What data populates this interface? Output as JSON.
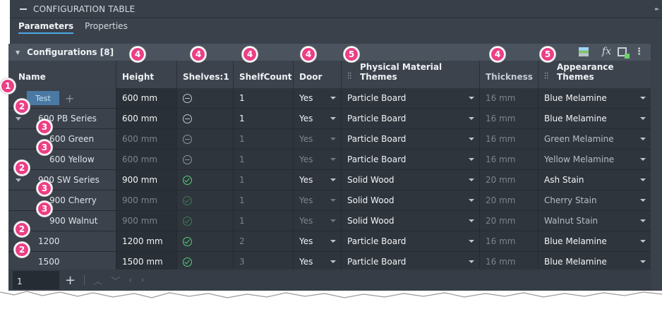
{
  "panel": {
    "title": "CONFIGURATION TABLE"
  },
  "tabs": [
    {
      "label": "Parameters",
      "active": true
    },
    {
      "label": "Properties",
      "active": false
    }
  ],
  "config_bar": {
    "label": "Configurations [8]"
  },
  "columns": {
    "name": "Name",
    "height": "Height",
    "shelves": "Shelves:1",
    "shelfcount": "ShelfCount",
    "door": "Door",
    "material": "Physical Material Themes",
    "thickness": "Thickness",
    "appearance": "Appearance Themes"
  },
  "rows": [
    {
      "name": "Test",
      "height": "600 mm",
      "shelves": "minus",
      "shelfcount": "1",
      "door": "Yes",
      "material": "Particle Board",
      "thickness": "16 mm",
      "appearance": "Blue Melamine",
      "badge": "1"
    },
    {
      "name": "600 PB Series",
      "height": "600 mm",
      "shelves": "minus",
      "shelfcount": "1",
      "door": "Yes",
      "material": "Particle Board",
      "thickness": "16 mm",
      "appearance": "Blue Melamine",
      "badge": "2"
    },
    {
      "name": "600 Green",
      "height": "600 mm",
      "shelves": "minus",
      "shelfcount": "1",
      "door": "Yes",
      "material": "Particle Board",
      "thickness": "16 mm",
      "appearance": "Green Melamine",
      "badge": "3"
    },
    {
      "name": "600 Yellow",
      "height": "600 mm",
      "shelves": "minus",
      "shelfcount": "1",
      "door": "Yes",
      "material": "Particle Board",
      "thickness": "16 mm",
      "appearance": "Yellow Melamine",
      "badge": "3"
    },
    {
      "name": "900 SW Series",
      "height": "900 mm",
      "shelves": "check",
      "shelfcount": "1",
      "door": "Yes",
      "material": "Solid Wood",
      "thickness": "20 mm",
      "appearance": "Ash Stain",
      "badge": "2"
    },
    {
      "name": "900 Cherry",
      "height": "900 mm",
      "shelves": "check",
      "shelfcount": "1",
      "door": "Yes",
      "material": "Solid Wood",
      "thickness": "20 mm",
      "appearance": "Cherry Stain",
      "badge": "3"
    },
    {
      "name": "900 Walnut",
      "height": "900 mm",
      "shelves": "check",
      "shelfcount": "1",
      "door": "Yes",
      "material": "Solid Wood",
      "thickness": "20 mm",
      "appearance": "Walnut Stain",
      "badge": "3"
    },
    {
      "name": "1200",
      "height": "1200 mm",
      "shelves": "check",
      "shelfcount": "2",
      "door": "Yes",
      "material": "Particle Board",
      "thickness": "16 mm",
      "appearance": "Blue Melamine",
      "badge": "2"
    },
    {
      "name": "1500",
      "height": "1500 mm",
      "shelves": "check",
      "shelfcount": "3",
      "door": "Yes",
      "material": "Particle Board",
      "thickness": "16 mm",
      "appearance": "Blue Melamine",
      "badge": "2"
    }
  ],
  "header_badges": {
    "height": "4",
    "shelves": "4",
    "shelfcount": "4",
    "door": "4",
    "material": "5",
    "thickness": "4",
    "appearance": "5"
  },
  "pager": {
    "page": "1"
  },
  "colors": {
    "accent": "#4aa8e6",
    "badge": "#ec3f85",
    "check": "#54d17a"
  }
}
